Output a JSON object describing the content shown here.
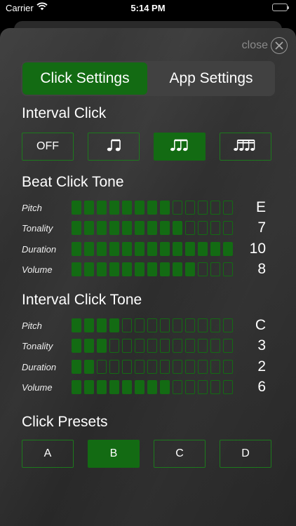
{
  "status_bar": {
    "carrier": "Carrier",
    "time": "5:14 PM"
  },
  "close": {
    "label": "close"
  },
  "tabs": [
    {
      "label": "Click Settings",
      "active": true
    },
    {
      "label": "App Settings",
      "active": false
    }
  ],
  "interval_click": {
    "title": "Interval Click",
    "options": [
      {
        "label": "OFF",
        "icon": "off",
        "selected": false
      },
      {
        "label": "♬",
        "icon": "eighth-notes-icon",
        "selected": false
      },
      {
        "label": "♫♫",
        "icon": "triplet-notes-icon",
        "selected": true
      },
      {
        "label": "♬♬",
        "icon": "sixteenth-notes-icon",
        "selected": false
      }
    ]
  },
  "beat_click_tone": {
    "title": "Beat Click Tone",
    "params": [
      {
        "label": "Pitch",
        "value": "E",
        "level": 8,
        "max": 13
      },
      {
        "label": "Tonality",
        "value": "7",
        "level": 9,
        "max": 13
      },
      {
        "label": "Duration",
        "value": "10",
        "level": 13,
        "max": 13
      },
      {
        "label": "Volume",
        "value": "8",
        "level": 10,
        "max": 13
      }
    ]
  },
  "interval_click_tone": {
    "title": "Interval Click Tone",
    "params": [
      {
        "label": "Pitch",
        "value": "C",
        "level": 4,
        "max": 13
      },
      {
        "label": "Tonality",
        "value": "3",
        "level": 3,
        "max": 13
      },
      {
        "label": "Duration",
        "value": "2",
        "level": 2,
        "max": 13
      },
      {
        "label": "Volume",
        "value": "6",
        "level": 8,
        "max": 13
      }
    ]
  },
  "click_presets": {
    "title": "Click Presets",
    "options": [
      {
        "label": "A",
        "selected": false
      },
      {
        "label": "B",
        "selected": true
      },
      {
        "label": "C",
        "selected": false
      },
      {
        "label": "D",
        "selected": false
      }
    ]
  },
  "colors": {
    "accent": "#136b13",
    "panel": "#2f2f2f",
    "tab_bg": "#414141"
  }
}
